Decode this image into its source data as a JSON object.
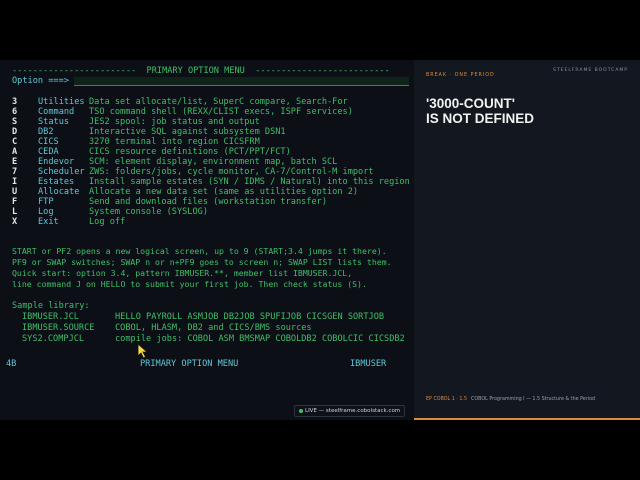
{
  "terminal": {
    "header_dashes_left": "------------------------",
    "header_title": "PRIMARY OPTION MENU",
    "header_dashes_right": "--------------------------",
    "option_prompt": "Option ===>",
    "option_value": "",
    "commands": [
      {
        "key": "3",
        "name": "Utilities",
        "desc": "Data set allocate/list, SuperC compare, Search-For"
      },
      {
        "key": "6",
        "name": "Command",
        "desc": "TSO command shell (REXX/CLIST execs, ISPF services)"
      },
      {
        "key": "S",
        "name": "Status",
        "desc": "JES2 spool: job status and output"
      },
      {
        "key": "D",
        "name": "DB2",
        "desc": "Interactive SQL against subsystem DSN1"
      },
      {
        "key": "C",
        "name": "CICS",
        "desc": "3270 terminal into region CICSFRM"
      },
      {
        "key": "A",
        "name": "CEDA",
        "desc": "CICS resource definitions (PCT/PPT/FCT)"
      },
      {
        "key": "E",
        "name": "Endevor",
        "desc": "SCM: element display, environment map, batch SCL"
      },
      {
        "key": "7",
        "name": "Scheduler",
        "desc": "ZWS: folders/jobs, cycle monitor, CA-7/Control-M import"
      },
      {
        "key": "I",
        "name": "Estates",
        "desc": "Install sample estates (SYN / IDMS / Natural) into this region"
      },
      {
        "key": "U",
        "name": "Allocate",
        "desc": "Allocate a new data set (same as utilities option 2)"
      },
      {
        "key": "F",
        "name": "FTP",
        "desc": "Send and download files (workstation transfer)"
      },
      {
        "key": "L",
        "name": "Log",
        "desc": "System console (SYSLOG)"
      },
      {
        "key": "X",
        "name": "Exit",
        "desc": "Log off"
      }
    ],
    "help_lines": [
      "START or PF2 opens a new logical screen, up to 9 (START;3.4 jumps it there).",
      "PF9 or SWAP switches; SWAP n or n+PF9 goes to screen n; SWAP LIST lists them.",
      "Quick start: option 3.4, pattern IBMUSER.**, member list IBMUSER.JCL,",
      "line command J on HELLO to submit your first job. Then check status (S)."
    ],
    "sample_library_heading": "Sample library:",
    "samples": [
      {
        "dsn": "IBMUSER.JCL",
        "members": "HELLO PAYROLL ASMJOB DB2JOB SPUFIJOB CICSGEN SORTJOB"
      },
      {
        "dsn": "IBMUSER.SOURCE",
        "members": "COBOL, HLASM, DB2 and CICS/BMS sources"
      },
      {
        "dsn": "SYS2.COMPJCL",
        "members": "compile jobs: COBOL ASM BMSMAP COBOLDB2 COBOLCIC CICSDB2"
      }
    ],
    "status": {
      "screen": "4B",
      "panel": "PRIMARY OPTION MENU",
      "user": "IBMUSER"
    },
    "live_badge": "LIVE — steelframe.cobolstack.com"
  },
  "slide": {
    "topline": "BREAK · ONE PERIOD",
    "brand": "STEELFRAME BOOTCAMP",
    "title_line1": "'3000-COUNT'",
    "title_line2": "IS NOT DEFINED",
    "footer_code": "EP COBOL 1 · 1.5",
    "footer_text": "COBOL Programming I — 1.5 Structure & the Period",
    "accent": "#d98b3c"
  }
}
